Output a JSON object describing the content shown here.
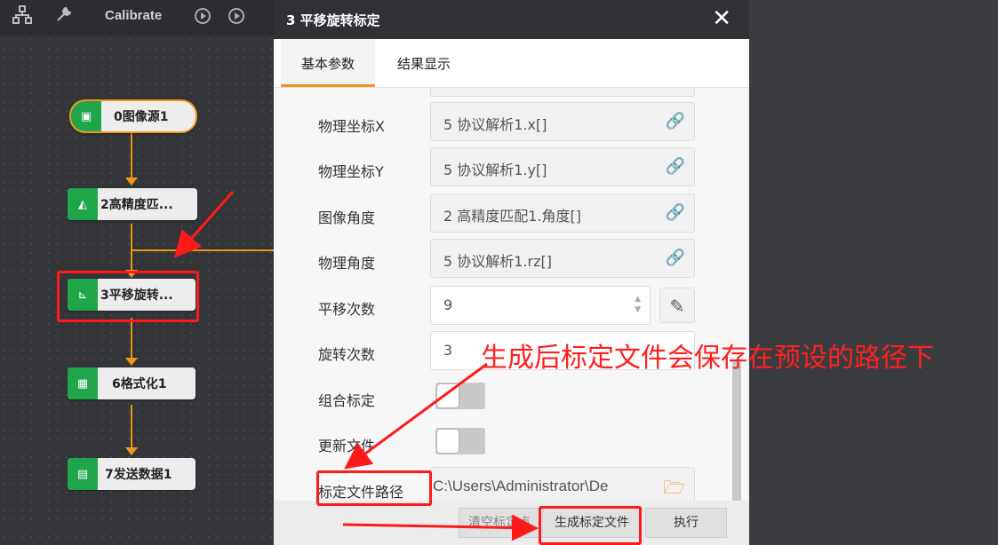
{
  "toolbar": {
    "items": [
      "flow-icon",
      "wrench-icon"
    ],
    "calibrate_label": "Calibrate"
  },
  "flow": {
    "nodes": [
      {
        "label": "0图像源1",
        "icon": "image-icon"
      },
      {
        "label": "2高精度匹...",
        "icon": "shape-match-icon"
      },
      {
        "label": "3平移旋转...",
        "icon": "calibration-icon"
      },
      {
        "label": "6格式化1",
        "icon": "format-icon"
      },
      {
        "label": "7发送数据1",
        "icon": "send-icon"
      }
    ]
  },
  "dialog": {
    "title": "3 平移旋转标定",
    "close": "✕",
    "tabs": [
      "基本参数",
      "结果显示"
    ],
    "fields": [
      {
        "label": "物理坐标X",
        "value": "5 协议解析1.x[]"
      },
      {
        "label": "物理坐标Y",
        "value": "5 协议解析1.y[]"
      },
      {
        "label": "图像角度",
        "value": "2 高精度匹配1.角度[]"
      },
      {
        "label": "物理角度",
        "value": "5 协议解析1.rz[]"
      }
    ],
    "translate_count": {
      "label": "平移次数",
      "value": "9"
    },
    "rotate_count": {
      "label": "旋转次数",
      "value": "3"
    },
    "combined_calib": {
      "label": "组合标定"
    },
    "update_file": {
      "label": "更新文件"
    },
    "calib_path": {
      "label": "标定文件路径",
      "value": "C:\\Users\\Administrator\\De"
    },
    "buttons": {
      "clear": "清空标定点",
      "generate": "生成标定文件",
      "execute": "执行"
    }
  },
  "annotation": {
    "text": "生成后标定文件会保存在预设的路径下"
  },
  "colors": {
    "accent": "#f0951b",
    "node_icon": "#1fa64b",
    "annotation": "#ff2020"
  }
}
